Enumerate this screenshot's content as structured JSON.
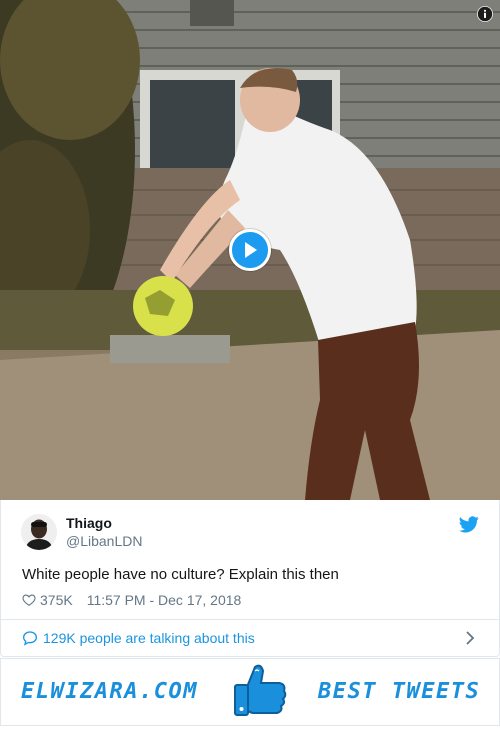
{
  "video": {
    "play_icon": "play-icon",
    "info_icon": "info-icon"
  },
  "tweet": {
    "author_name": "Thiago",
    "author_handle": "@LibanLDN",
    "text": "White people have no culture? Explain this then",
    "likes": "375K",
    "timestamp": "11:57 PM - Dec 17, 2018",
    "brand_icon": "twitter-bird-icon"
  },
  "conversation": {
    "label": "129K people are talking about this"
  },
  "banner": {
    "left_text": "ELWIZARA.COM",
    "right_text": "BEST TWEETS",
    "logo_icon": "thumbs-up-icon"
  },
  "colors": {
    "accent": "#1da1f2",
    "link": "#1b95e0",
    "brand": "#1a8fdc",
    "muted": "#657786"
  }
}
